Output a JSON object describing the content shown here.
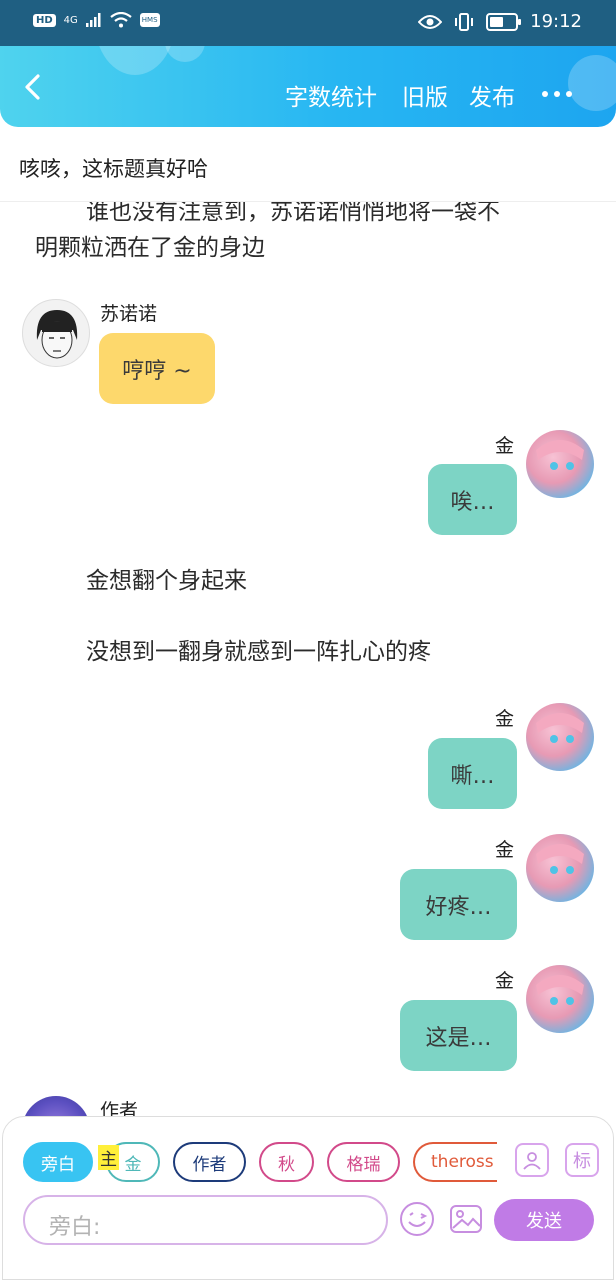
{
  "status_bar": {
    "left_badges": [
      "HD",
      "4G",
      "HMS"
    ],
    "time": "19:12",
    "battery_level": 0.45
  },
  "header": {
    "actions": [
      "字数统计",
      "旧版",
      "发布"
    ]
  },
  "story_title": "咳咳，这标题真好哈",
  "messages": [
    {
      "type": "narration",
      "lines": [
        "谁也没有注意到，苏诺诺悄悄地将一袋不",
        "明颗粒洒在了金的身边"
      ]
    },
    {
      "type": "left",
      "speaker": "苏诺诺",
      "text": "哼哼 ~"
    },
    {
      "type": "right",
      "speaker": "金",
      "text": "唉…"
    },
    {
      "type": "narration",
      "lines": [
        "金想翻个身起来"
      ]
    },
    {
      "type": "narration",
      "lines": [
        "没想到一翻身就感到一阵扎心的疼"
      ]
    },
    {
      "type": "right",
      "speaker": "金",
      "text": "嘶…"
    },
    {
      "type": "right",
      "speaker": "金",
      "text": "好疼…"
    },
    {
      "type": "right",
      "speaker": "金",
      "text": "这是…"
    },
    {
      "type": "left",
      "speaker": "作者",
      "text": ""
    }
  ],
  "role_chips": [
    {
      "label": "旁白",
      "color": "#38c4f2"
    },
    {
      "label": "金",
      "color": "#4fb8b8"
    },
    {
      "label": "作者",
      "color": "#1d3b7a"
    },
    {
      "label": "秋",
      "color": "#d24a8a"
    },
    {
      "label": "格瑞",
      "color": "#d24a8a"
    },
    {
      "label": "theross",
      "color": "#e05a3a"
    }
  ],
  "main_badge": "主",
  "tool_icons": {
    "role_icon": "person-card-icon",
    "tag_label": "标"
  },
  "input": {
    "placeholder": "旁白:"
  },
  "send_label": "发送"
}
